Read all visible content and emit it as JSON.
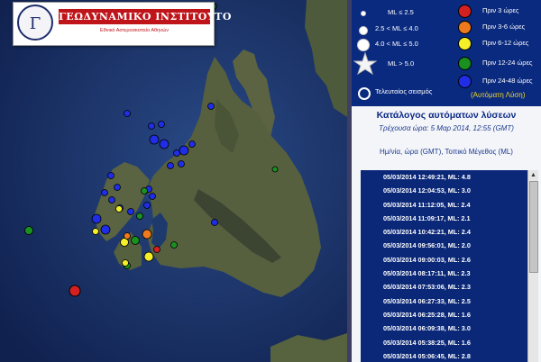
{
  "logo": {
    "seal_text": "Γ",
    "title": "ΓΕΩΔΥΝΑΜΙΚΟ ΙΝΣΤΙΤΟΥΤΟ",
    "subtitle": "Εθνικό Αστεροσκοπείο Αθηνών"
  },
  "legend": {
    "magnitudes": [
      {
        "label": "ML ≤ 2.5",
        "icon": "small-white-dot-icon"
      },
      {
        "label": "2.5 < ML ≤ 4.0",
        "icon": "medium-white-dot-icon"
      },
      {
        "label": "4.0 < ML ≤ 5.0",
        "icon": "large-white-dot-icon"
      },
      {
        "label": "ML > 5.0",
        "icon": "star-icon"
      },
      {
        "label": "Τελευταίος σεισμός",
        "icon": "ring-icon"
      }
    ],
    "ages": [
      {
        "label": "Πριν 3 ώρες",
        "color": "#d42020"
      },
      {
        "label": "Πριν 3-6 ώρες",
        "color": "#ef7a1e"
      },
      {
        "label": "Πριν 6-12 ώρες",
        "color": "#f4ef27"
      },
      {
        "label": "Πριν 12-24 ώρες",
        "color": "#19901f"
      },
      {
        "label": "Πριν 24-48 ώρες",
        "color": "#1f2ee6"
      }
    ],
    "auto_label": "(Αυτόματη Λύση)"
  },
  "catalog": {
    "title": "Κατάλογος αυτόματων λύσεων",
    "current_time": "Τρέχουσα ώρα: 5 Μαρ 2014, 12:55 (GMT)",
    "header": "Ημ/νία, ώρα (GMT), Τοπικό Μέγεθος (ML)",
    "events": [
      "05/03/2014 12:49:21, ML: 4.8",
      "05/03/2014 12:04:53, ML: 3.0",
      "05/03/2014 11:12:05, ML: 2.4",
      "05/03/2014 11:09:17, ML: 2.1",
      "05/03/2014 10:42:21, ML: 2.4",
      "05/03/2014 09:56:01, ML: 2.0",
      "05/03/2014 09:00:03, ML: 2.6",
      "05/03/2014 08:17:11, ML: 2.3",
      "05/03/2014 07:53:06, ML: 2.3",
      "05/03/2014 06:27:33, ML: 2.5",
      "05/03/2014 06:25:28, ML: 1.6",
      "05/03/2014 06:09:38, ML: 3.0",
      "05/03/2014 05:38:25, ML: 1.6",
      "05/03/2014 05:06:45, ML: 2.8"
    ]
  }
}
